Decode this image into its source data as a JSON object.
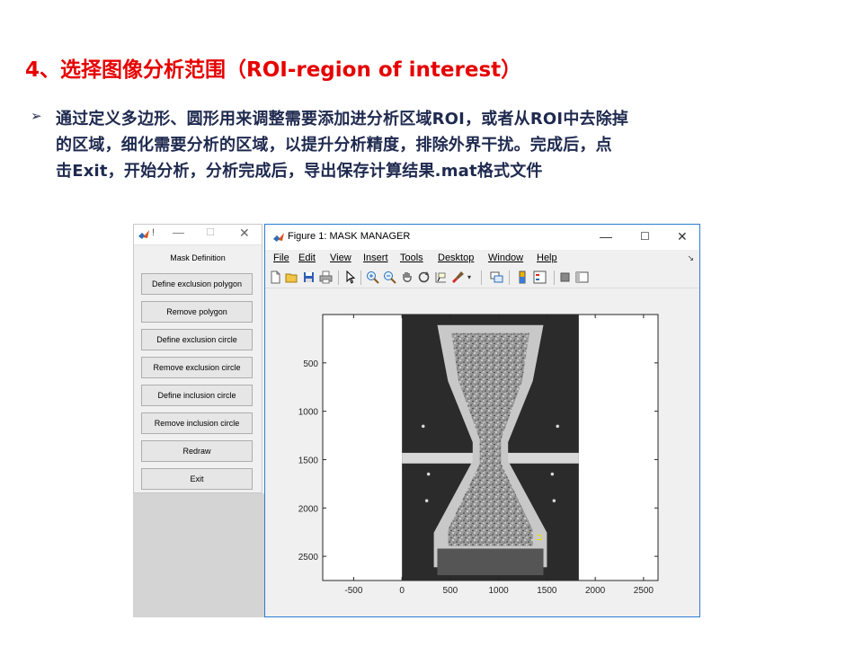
{
  "slide": {
    "title": "4、选择图像分析范围（ROI-region of interest）",
    "bullet_marker": "➢",
    "bullet_line1": "通过定义多边形、圆形用来调整需要添加进分析区域ROI，或者从ROI中去除掉",
    "bullet_line2": "的区域，细化需要分析的区域，以提升分析精度，排除外界干扰。完成后，点",
    "bullet_line3": "击Exit，开始分析，分析完成后，导出保存计算结果.mat格式文件"
  },
  "mask_window": {
    "title_glyph": "!",
    "minimize": "—",
    "maximize": "☐",
    "close": "✕",
    "header": "Mask Definition",
    "buttons": [
      "Define exclusion polygon",
      "Remove polygon",
      "Define exclusion circle",
      "Remove exclusion circle",
      "Define inclusion circle",
      "Remove inclusion circle",
      "Redraw",
      "Exit"
    ]
  },
  "figure_window": {
    "title": "Figure 1: MASK MANAGER",
    "minimize": "—",
    "maximize": "☐",
    "close": "✕",
    "menu": [
      "File",
      "Edit",
      "View",
      "Insert",
      "Tools",
      "Desktop",
      "Window",
      "Help"
    ],
    "menu_overflow": "↘",
    "toolbar_icons": [
      "new-figure-icon",
      "open-icon",
      "save-icon",
      "print-icon",
      "pointer-icon",
      "zoom-in-icon",
      "zoom-out-icon",
      "pan-icon",
      "rotate-icon",
      "data-cursor-icon",
      "brush-icon",
      "link-plot-icon",
      "colorbar-icon",
      "legend-icon",
      "hide-plot-tools-icon",
      "show-plot-tools-icon"
    ]
  },
  "chart_data": {
    "type": "image",
    "x_ticks": [
      -500,
      0,
      500,
      1000,
      1500,
      2000,
      2500
    ],
    "y_ticks": [
      500,
      1000,
      1500,
      2000,
      2500
    ],
    "xlim": [
      -820,
      2650
    ],
    "ylim": [
      0,
      2750
    ],
    "y_reversed": true,
    "image_extent_x": [
      0,
      1830
    ],
    "image_extent_y": [
      0,
      2750
    ]
  }
}
